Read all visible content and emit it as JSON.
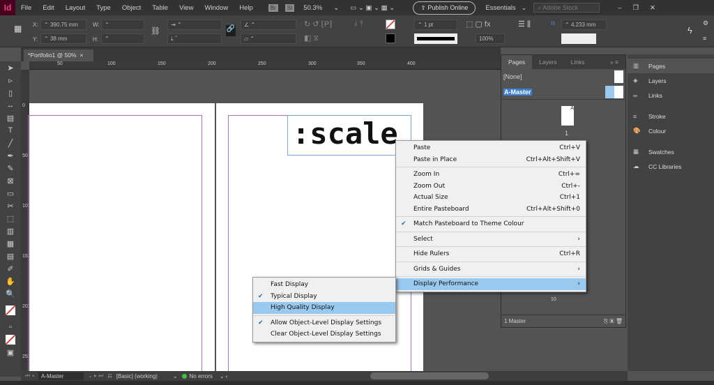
{
  "app": {
    "logo": "Id"
  },
  "menubar": {
    "items": [
      "File",
      "Edit",
      "Layout",
      "Type",
      "Object",
      "Table",
      "View",
      "Window",
      "Help"
    ],
    "bridge": "Br",
    "stock": "St",
    "zoom": "50.3%",
    "publish": "Publish Online",
    "workspace": "Essentials",
    "search_placeholder": "Adobe Stock"
  },
  "control": {
    "x_label": "X:",
    "x_value": "390.75 mm",
    "y_label": "Y:",
    "y_value": "38 mm",
    "w_label": "W:",
    "h_label": "H:",
    "stroke_weight": "1 pt",
    "opacity": "100%",
    "gap": "4.233 mm"
  },
  "document": {
    "tab_title": "*Portfolio1 @ 50%",
    "close": "×",
    "frame_text": ":scale"
  },
  "ruler": {
    "h_ticks": [
      "50",
      "100",
      "150",
      "200",
      "250",
      "300",
      "350",
      "400"
    ],
    "v_ticks": [
      "0",
      "50",
      "100",
      "150",
      "200",
      "250"
    ]
  },
  "pages_panel": {
    "tabs": [
      "Pages",
      "Layers",
      "Links"
    ],
    "none": "[None]",
    "master": "A-Master",
    "page_number": "1",
    "page_10": "10",
    "footer": "1 Master",
    "page_master_letter": "A"
  },
  "dock": {
    "items": [
      "Pages",
      "Layers",
      "Links",
      "Stroke",
      "Colour",
      "Swatches",
      "CC Libraries"
    ]
  },
  "context_menu": {
    "items": [
      {
        "label": "Paste",
        "shortcut": "Ctrl+V"
      },
      {
        "label": "Paste in Place",
        "shortcut": "Ctrl+Alt+Shift+V"
      },
      {
        "label": "Zoom In",
        "shortcut": "Ctrl+="
      },
      {
        "label": "Zoom Out",
        "shortcut": "Ctrl+-"
      },
      {
        "label": "Actual Size",
        "shortcut": "Ctrl+1"
      },
      {
        "label": "Entire Pasteboard",
        "shortcut": "Ctrl+Alt+Shift+0"
      },
      {
        "label": "Match Pasteboard to Theme Colour",
        "checked": true
      },
      {
        "label": "Select",
        "arrow": "›"
      },
      {
        "label": "Hide Rulers",
        "shortcut": "Ctrl+R"
      },
      {
        "label": "Grids & Guides",
        "arrow": "›"
      },
      {
        "label": "Display Performance",
        "arrow": "›"
      }
    ]
  },
  "submenu": {
    "items": [
      {
        "label": "Fast Display"
      },
      {
        "label": "Typical Display",
        "checked": true
      },
      {
        "label": "High Quality Display"
      },
      {
        "label": "Allow Object-Level Display Settings",
        "checked": true
      },
      {
        "label": "Clear Object-Level Display Settings"
      }
    ]
  },
  "status": {
    "page": "A-Master",
    "preflight_profile": "[Basic] (working)",
    "errors": "No errors"
  },
  "colors": {
    "accent": "#99c9ef",
    "margin": "#b26bbf",
    "ok": "#3fbf3f"
  }
}
